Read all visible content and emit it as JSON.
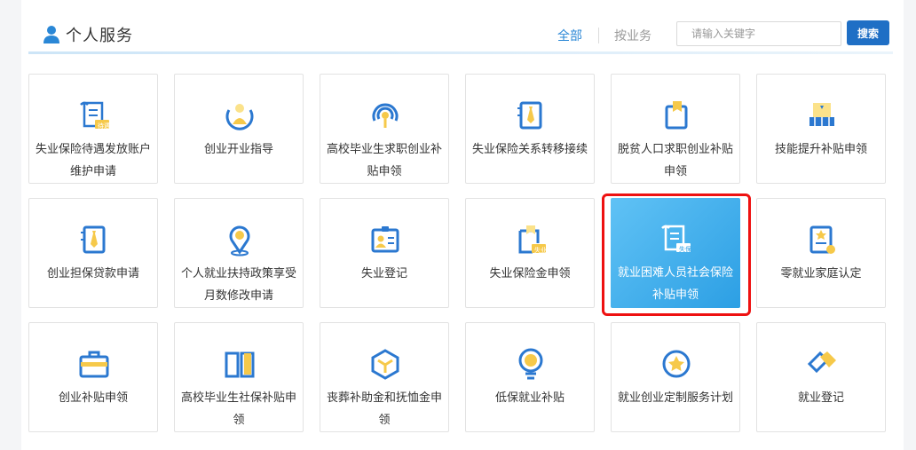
{
  "header": {
    "title": "个人服务",
    "tab_all": "全部",
    "tab_by_business": "按业务",
    "search_placeholder": "请输入关键字",
    "search_button": "搜索"
  },
  "colors": {
    "accent": "#2a87d6",
    "search_button": "#1f6fc5",
    "icon_blue": "#2b78d0",
    "icon_yellow": "#f6c94a",
    "active_card_start": "#60c2f5",
    "active_card_end": "#2c9fe4",
    "highlight_border": "#e11111"
  },
  "services": [
    {
      "label": "失业保险待遇发放账户维护申请",
      "icon": "scroll-badge-icon"
    },
    {
      "label": "创业开业指导",
      "icon": "person-circle-icon"
    },
    {
      "label": "高校毕业生求职创业补贴申领",
      "icon": "signal-tower-icon"
    },
    {
      "label": "失业保险关系转移接续",
      "icon": "tie-folder-icon"
    },
    {
      "label": "脱贫人口求职创业补贴申领",
      "icon": "flag-document-icon"
    },
    {
      "label": "技能提升补贴申领",
      "icon": "certificate-stack-icon"
    },
    {
      "label": "创业担保贷款申请",
      "icon": "tie-folder-icon"
    },
    {
      "label": "个人就业扶持政策享受月数修改申请",
      "icon": "location-pin-icon"
    },
    {
      "label": "失业登记",
      "icon": "id-card-icon"
    },
    {
      "label": "失业保险金申领",
      "icon": "document-badge-icon"
    },
    {
      "label": "就业困难人员社会保险补贴申领",
      "icon": "scroll-badge-icon",
      "active": true
    },
    {
      "label": "零就业家庭认定",
      "icon": "certificate-star-icon"
    },
    {
      "label": "创业补贴申领",
      "icon": "briefcase-icon"
    },
    {
      "label": "高校毕业生社保补贴申领",
      "icon": "open-book-icon"
    },
    {
      "label": "丧葬补助金和抚恤金申领",
      "icon": "cube-icon"
    },
    {
      "label": "低保就业补贴",
      "icon": "lightbulb-icon"
    },
    {
      "label": "就业创业定制服务计划",
      "icon": "star-badge-icon"
    },
    {
      "label": "就业登记",
      "icon": "diamond-tag-icon"
    }
  ],
  "badges": {
    "badge_0": "待遇",
    "badge_9": "失业",
    "badge_10": "失保"
  }
}
